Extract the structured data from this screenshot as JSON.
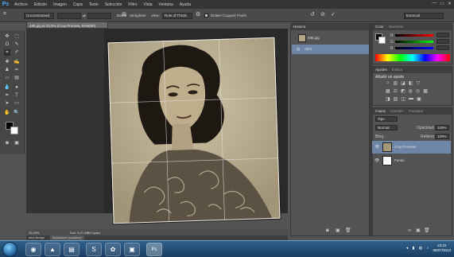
{
  "app": {
    "logo": "Ps"
  },
  "menu": [
    "Archivo",
    "Edición",
    "Imagen",
    "Capa",
    "Texto",
    "Selección",
    "Filtro",
    "Vista",
    "Ventana",
    "Ayuda"
  ],
  "window_controls": [
    "—",
    "▭",
    "✕"
  ],
  "options": {
    "ratio_value": "Unconstrained",
    "swap_icon": "⇄",
    "straighten_label": "Straighten",
    "view_label": "View:",
    "view_value": "Rule of Thirds",
    "delete_label": "Delete Cropped Pixels",
    "delete_checked": true,
    "workspace_value": "Esencial"
  },
  "document": {
    "tab_title": "488.jpg al 33,3% (Crop Preview, RGB/8#)",
    "zoom": "33,33%",
    "doc_info": "Doc: 6,21 MB/0 bytes"
  },
  "bottom_tabs": [
    "Mini Bridge",
    "Animación (cuadros)"
  ],
  "history": {
    "title": "Historia",
    "items": [
      "488.jpg",
      "Abrir"
    ]
  },
  "color_panel": {
    "tabs": [
      "Color",
      "Muestras"
    ],
    "channels": [
      "R",
      "G",
      "B"
    ]
  },
  "adjustments": {
    "tabs": [
      "Ajustes",
      "Estilos"
    ],
    "heading": "Añadir un ajuste"
  },
  "layers": {
    "tabs": [
      "Capas",
      "Canales",
      "Trazados"
    ],
    "kind_label": "Tipo",
    "blend_mode": "Normal",
    "opacity_label": "Opacidad:",
    "opacity_value": "100%",
    "lock_label": "Bloq.:",
    "fill_label": "Relleno:",
    "fill_value": "100%",
    "items": [
      {
        "name": "Crop Preview",
        "selected": true
      },
      {
        "name": "Fondo",
        "selected": false
      }
    ]
  },
  "taskbar": {
    "time": "23:22",
    "date": "06/07/2013"
  }
}
